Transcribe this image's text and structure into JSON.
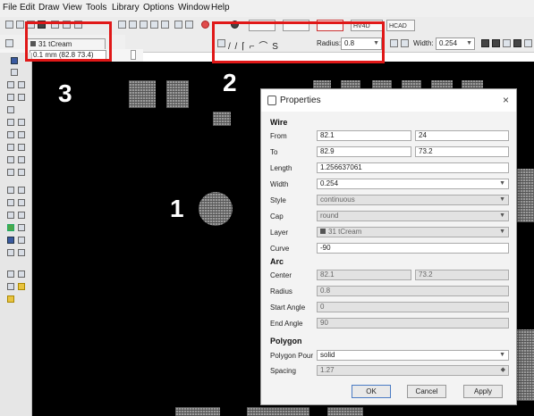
{
  "menu": [
    "File",
    "Edit",
    "Draw",
    "View",
    "Tools",
    "Library",
    "Options",
    "Window",
    "Help"
  ],
  "toolbar": {
    "layer_value": "31 tCream",
    "coordinates": "0.1 mm (82.8 73.4)",
    "radius_label": "Radius:",
    "radius_value": "0.8",
    "width_label": "Width:",
    "width_value": "0.254",
    "btn_hbw": "HCAD",
    "btn_hv": "HV4D"
  },
  "callouts": [
    "1",
    "2",
    "3"
  ],
  "highlight_color": "#e01818",
  "dialog": {
    "title": "Properties",
    "close_glyph": "×",
    "wire": {
      "section": "Wire",
      "from_label": "From",
      "from_x": "82.1",
      "from_y": "24",
      "to_label": "To",
      "to_x": "82.9",
      "to_y": "73.2",
      "length_label": "Length",
      "length_value": "1.256637061",
      "width_label": "Width",
      "width_value": "0.254",
      "style_label": "Style",
      "style_value": "continuous",
      "cap_label": "Cap",
      "cap_value": "round",
      "layer_label": "Layer",
      "layer_value": "31 tCream",
      "curve_label": "Curve",
      "curve_value": "-90"
    },
    "arc": {
      "section": "Arc",
      "center_label": "Center",
      "center_x": "82.1",
      "center_y": "73.2",
      "radius_label": "Radius",
      "radius_value": "0.8",
      "start_label": "Start Angle",
      "start_value": "0",
      "end_label": "End Angle",
      "end_value": "90"
    },
    "polygon": {
      "section": "Polygon",
      "pour_label": "Polygon Pour",
      "pour_value": "solid",
      "spacing_label": "Spacing",
      "spacing_value": "1.27"
    },
    "buttons": {
      "ok": "OK",
      "cancel": "Cancel",
      "apply": "Apply"
    }
  }
}
